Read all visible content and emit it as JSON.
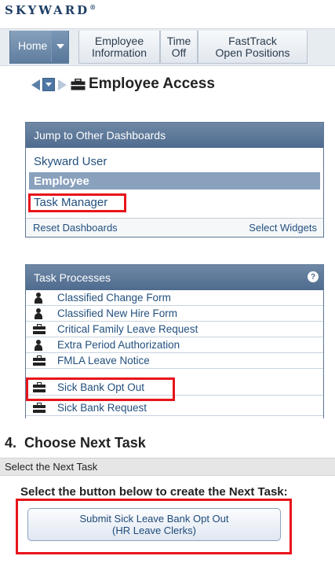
{
  "logo": {
    "text": "SKYWARD",
    "mark": "®"
  },
  "topnav": {
    "home": "Home",
    "tabs": [
      {
        "line1": "Employee",
        "line2": "Information"
      },
      {
        "line1": "Time",
        "line2": "Off"
      },
      {
        "line1": "FastTrack",
        "line2": "Open Positions"
      }
    ]
  },
  "page": {
    "title": "Employee Access"
  },
  "jump_panel": {
    "title": "Jump to Other Dashboards",
    "items": [
      "Skyward User",
      "Employee",
      "Task Manager"
    ],
    "reset": "Reset Dashboards",
    "select_widgets": "Select Widgets"
  },
  "task_panel": {
    "title": "Task Processes",
    "help": "?",
    "items": [
      {
        "label": "Classified Change Form",
        "icon": "person-icon"
      },
      {
        "label": "Classified New Hire Form",
        "icon": "person-icon"
      },
      {
        "label": "Critical Family Leave Request",
        "icon": "briefcase-icon"
      },
      {
        "label": "Extra Period Authorization",
        "icon": "person-icon"
      },
      {
        "label": "FMLA Leave Notice",
        "icon": "briefcase-icon"
      },
      {
        "label": "Sick Bank Opt Out",
        "icon": "briefcase-icon"
      },
      {
        "label": "Sick Bank Request",
        "icon": "briefcase-icon"
      }
    ]
  },
  "step": {
    "title": "4.  Choose Next Task",
    "section": "Select the Next Task",
    "instruction": "Select the button below to create the Next Task:",
    "button_line1": "Submit Sick Leave Bank Opt Out",
    "button_line2": "(HR Leave Clerks)"
  },
  "highlight_color": "#e8141b"
}
